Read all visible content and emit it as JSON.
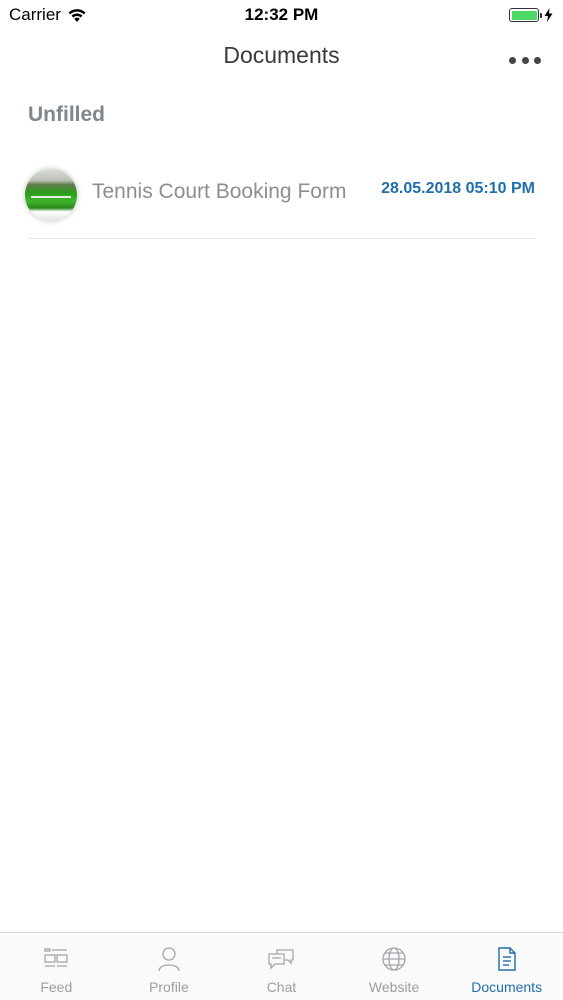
{
  "status_bar": {
    "carrier": "Carrier",
    "time": "12:32 PM"
  },
  "header": {
    "title": "Documents",
    "more_icon": "more-icon"
  },
  "section": {
    "title": "Unfilled"
  },
  "documents": [
    {
      "title": "Tennis Court Booking Form",
      "date": "28.05.2018 05:10 PM"
    }
  ],
  "tabs": [
    {
      "label": "Feed",
      "icon": "feed-icon"
    },
    {
      "label": "Profile",
      "icon": "profile-icon"
    },
    {
      "label": "Chat",
      "icon": "chat-icon"
    },
    {
      "label": "Website",
      "icon": "globe-icon"
    },
    {
      "label": "Documents",
      "icon": "document-icon",
      "active": true
    }
  ],
  "colors": {
    "accent": "#1f6fad",
    "inactive": "#9a9ea3",
    "section": "#7f868d",
    "battery": "#4cd964"
  }
}
